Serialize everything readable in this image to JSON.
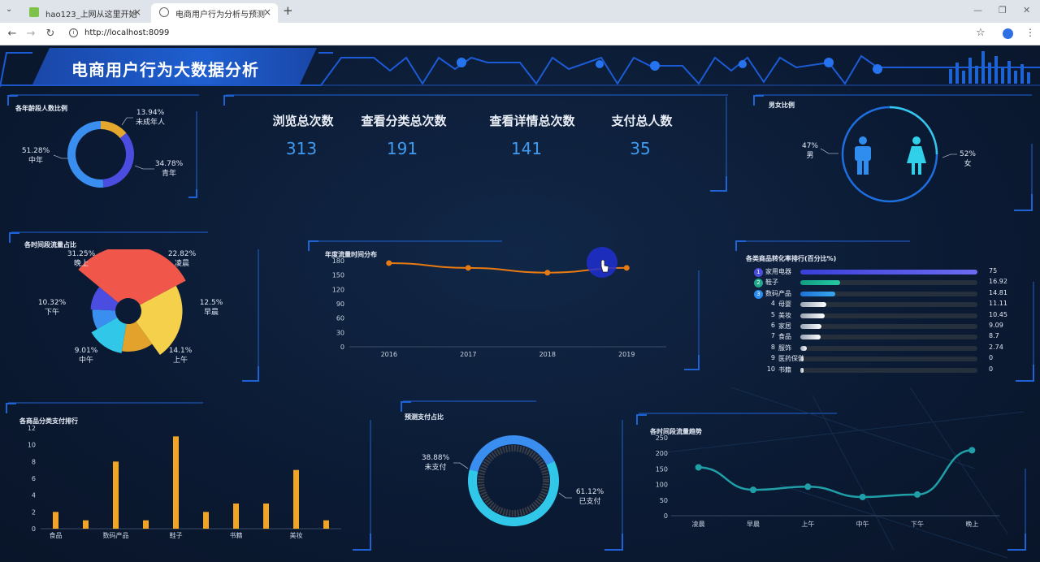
{
  "browser": {
    "tabs": [
      {
        "label": "hao123_上网从这里开始"
      },
      {
        "label": "电商用户行为分析与预测"
      }
    ],
    "url": "http://localhost:8099"
  },
  "dashboard": {
    "title": "电商用户行为大数据分析",
    "stats": [
      {
        "label": "浏览总次数",
        "value": "313"
      },
      {
        "label": "查看分类总次数",
        "value": "191"
      },
      {
        "label": "查看详情总次数",
        "value": "141"
      },
      {
        "label": "支付总人数",
        "value": "35"
      }
    ],
    "panels": {
      "age": "各年龄段人数比例",
      "gender": "男女比例",
      "period_share": "各时间段流量占比",
      "year_flow": "年度流量时间分布",
      "conversion": "各类商品转化率排行(百分比%)",
      "category_pay": "各商品分类支付排行",
      "pay_ratio": "预测支付占比",
      "period_trend": "各时间段流量趋势"
    },
    "age_labels": [
      {
        "pct": "13.94%",
        "name": "未成年人"
      },
      {
        "pct": "34.78%",
        "name": "青年"
      },
      {
        "pct": "51.28%",
        "name": "中年"
      }
    ],
    "gender_labels": [
      {
        "pct": "47%",
        "name": "男"
      },
      {
        "pct": "52%",
        "name": "女"
      }
    ],
    "period_labels": [
      {
        "pct": "31.25%",
        "name": "晚上"
      },
      {
        "pct": "22.82%",
        "name": "凌晨"
      },
      {
        "pct": "12.5%",
        "name": "早晨"
      },
      {
        "pct": "14.1%",
        "name": "上午"
      },
      {
        "pct": "9.01%",
        "name": "中午"
      },
      {
        "pct": "10.32%",
        "name": "下午"
      }
    ],
    "pay_labels": [
      {
        "pct": "38.88%",
        "name": "未支付"
      },
      {
        "pct": "61.12%",
        "name": "已支付"
      }
    ],
    "ranking": [
      {
        "rank": "1",
        "name": "家用电器",
        "value": 75
      },
      {
        "rank": "2",
        "name": "鞋子",
        "value": 16.92
      },
      {
        "rank": "3",
        "name": "数码产品",
        "value": 14.81
      },
      {
        "rank": "4",
        "name": "母婴",
        "value": 11.11
      },
      {
        "rank": "5",
        "name": "美妆",
        "value": 10.45
      },
      {
        "rank": "6",
        "name": "家居",
        "value": 9.09
      },
      {
        "rank": "7",
        "name": "食品",
        "value": 8.7
      },
      {
        "rank": "8",
        "name": "服饰",
        "value": 2.74
      },
      {
        "rank": "9",
        "name": "医药保健",
        "value": 0
      },
      {
        "rank": "10",
        "name": "书籍",
        "value": 0
      }
    ]
  },
  "chart_data": [
    {
      "type": "pie",
      "title": "各年龄段人数比例",
      "categories": [
        "未成年人",
        "青年",
        "中年"
      ],
      "values": [
        13.94,
        34.78,
        51.28
      ],
      "colors": [
        "#e5a72e",
        "#4b4de0",
        "#3a8ef0"
      ]
    },
    {
      "type": "pie",
      "title": "男女比例",
      "categories": [
        "男",
        "女"
      ],
      "values": [
        47,
        52
      ]
    },
    {
      "type": "pie",
      "title": "各时间段流量占比",
      "categories": [
        "晚上",
        "凌晨",
        "早晨",
        "上午",
        "中午",
        "下午"
      ],
      "values": [
        31.25,
        22.82,
        12.5,
        14.1,
        9.01,
        10.32
      ],
      "colors": [
        "#f0574a",
        "#f5d04a",
        "#e2a22b",
        "#31c7e8",
        "#3a8ef0",
        "#4b4de0"
      ]
    },
    {
      "type": "line",
      "title": "年度流量时间分布",
      "x": [
        "2016",
        "2017",
        "2018",
        "2019"
      ],
      "y": [
        175,
        165,
        155,
        165
      ],
      "ylim": [
        0,
        180
      ],
      "yticks": [
        0,
        30,
        60,
        90,
        120,
        150,
        180
      ],
      "color": "#e87a12"
    },
    {
      "type": "bar",
      "title": "各商品分类支付排行",
      "x_tick_labels": [
        "食品",
        "数码产品",
        "鞋子",
        "书籍",
        "美妆"
      ],
      "values": [
        2,
        1,
        8,
        1,
        11,
        2,
        3,
        3,
        7,
        1
      ],
      "ylim": [
        0,
        12
      ],
      "yticks": [
        0,
        2,
        4,
        6,
        8,
        10,
        12
      ],
      "color": "#f0a526"
    },
    {
      "type": "pie",
      "title": "预测支付占比",
      "categories": [
        "未支付",
        "已支付"
      ],
      "values": [
        38.88,
        61.12
      ],
      "colors": [
        "#3a8ef0",
        "#31c7e8"
      ]
    },
    {
      "type": "line",
      "title": "各时间段流量趋势",
      "x": [
        "凌晨",
        "早晨",
        "上午",
        "中午",
        "下午",
        "晚上"
      ],
      "y": [
        155,
        83,
        93,
        60,
        68,
        210
      ],
      "ylim": [
        0,
        250
      ],
      "yticks": [
        0,
        50,
        100,
        150,
        200,
        250
      ],
      "color": "#1fa0a8"
    }
  ]
}
